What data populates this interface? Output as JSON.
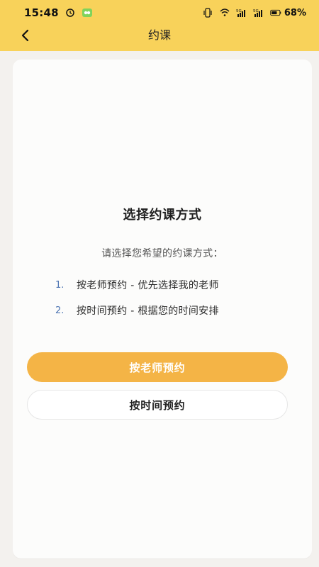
{
  "status_bar": {
    "time": "15:48",
    "battery": "68%",
    "left_icons": [
      "alarm-icon",
      "wechat-icon"
    ],
    "right_icons": [
      "vibration-icon",
      "wifi-icon",
      "signal-5g-icon",
      "signal-5g-icon",
      "battery-icon"
    ]
  },
  "nav": {
    "title": "约课",
    "back_icon": "chevron-left-icon"
  },
  "card": {
    "title": "选择约课方式",
    "subtitle": "请选择您希望的约课方式：",
    "options": [
      {
        "index": "1.",
        "text": "按老师预约 - 优先选择我的老师"
      },
      {
        "index": "2.",
        "text": "按时间预约 - 根据您的时间安排"
      }
    ],
    "primary_button": "按老师预约",
    "secondary_button": "按时间预约"
  },
  "colors": {
    "top_bar": "#f8d25a",
    "primary": "#f4b446",
    "index": "#4f76b3"
  }
}
